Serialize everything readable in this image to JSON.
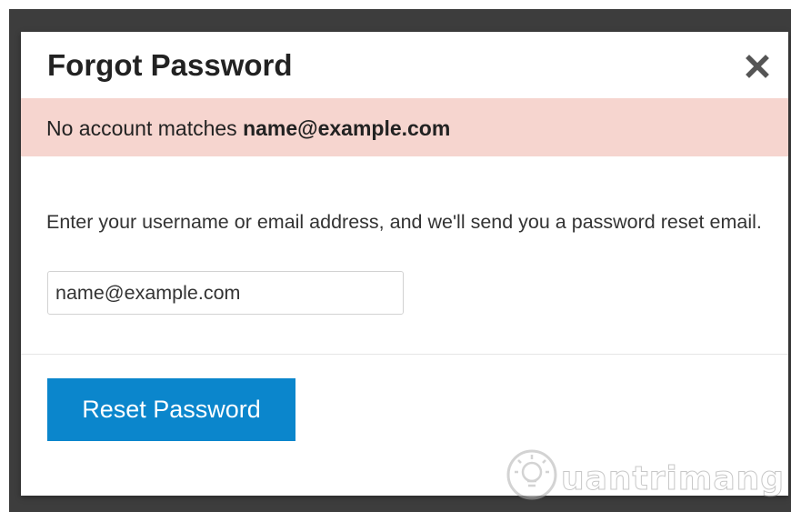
{
  "dialog": {
    "title": "Forgot Password",
    "close_icon": "close-icon"
  },
  "alert": {
    "prefix": "No account matches ",
    "email": "name@example.com",
    "background_color": "#f6d5cf"
  },
  "form": {
    "instructions": "Enter your username or email address, and we'll send you a password reset email.",
    "email_value": "name@example.com"
  },
  "actions": {
    "reset_label": "Reset Password",
    "button_color": "#0b86cc"
  },
  "watermark": {
    "text": "uantrimang",
    "icon": "lightbulb-logo"
  }
}
